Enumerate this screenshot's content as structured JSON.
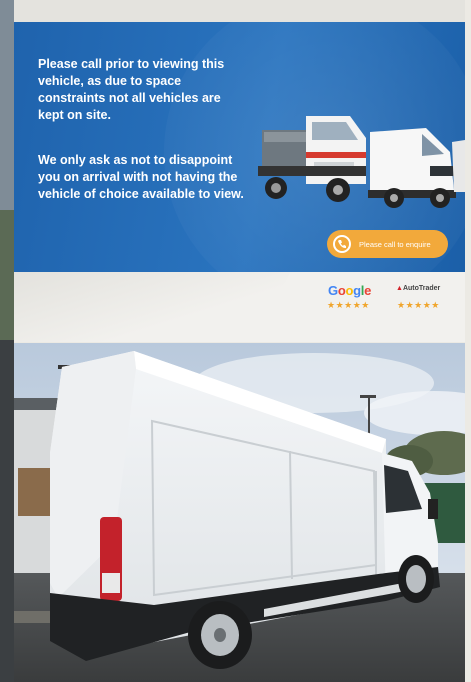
{
  "banner": {
    "message_1": "Please call prior to viewing this vehicle, as due to space constraints not all vehicles are kept on site.",
    "message_2": "We only ask as not to disappoint you on arrival with not having the vehicle of choice available to view.",
    "cta_label": "Please call to enquire",
    "google_logo": "Google",
    "autotrader_logo": "AutoTrader",
    "google_stars": "★★★★★",
    "autotrader_stars": "★★★★★",
    "colors": {
      "blue": "#1f63ad",
      "cta": "#f2a93b",
      "star": "#f0a52c"
    },
    "icons": [
      "phone-icon"
    ]
  },
  "photo": {
    "subject": "white high-roof panel van"
  }
}
